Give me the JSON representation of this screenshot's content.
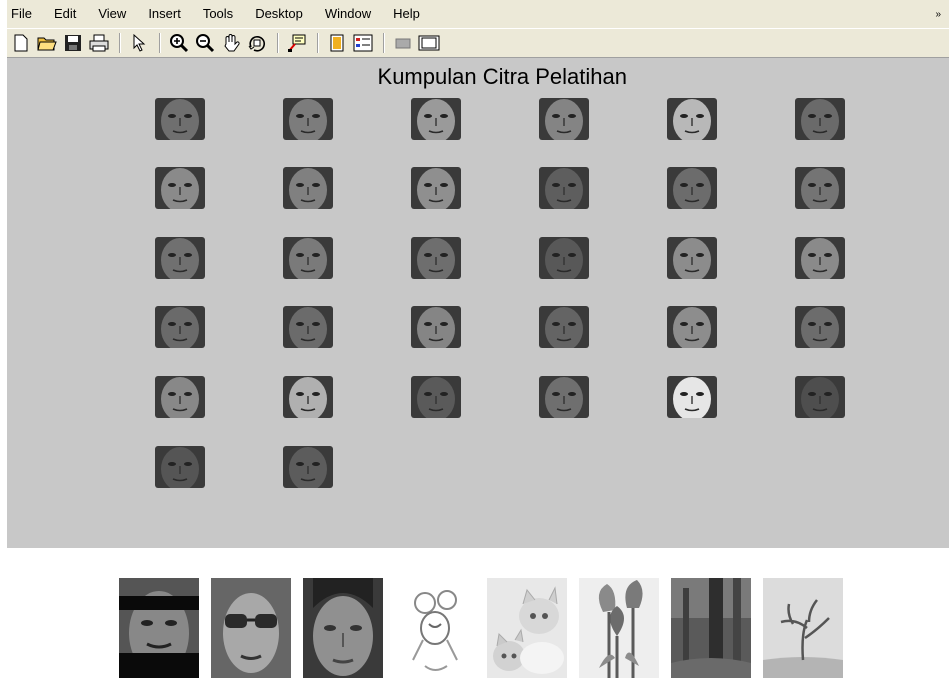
{
  "menubar": {
    "items": [
      "File",
      "Edit",
      "View",
      "Insert",
      "Tools",
      "Desktop",
      "Window",
      "Help"
    ]
  },
  "toolbar": {
    "icons": [
      "new-figure-icon",
      "open-file-icon",
      "save-icon",
      "print-icon",
      "edit-plot-arrow-icon",
      "zoom-in-icon",
      "zoom-out-icon",
      "pan-hand-icon",
      "rotate-3d-icon",
      "data-cursor-icon",
      "colorbar-icon",
      "legend-icon",
      "hide-plot-tools-icon",
      "show-plot-tools-icon"
    ]
  },
  "figure": {
    "title": "Kumpulan Citra Pelatihan",
    "background": "#c8c8c8",
    "faces": [
      {
        "tone": "#6f6f6f"
      },
      {
        "tone": "#7c7c7c"
      },
      {
        "tone": "#9a9a9a"
      },
      {
        "tone": "#848484"
      },
      {
        "tone": "#b8b8b8"
      },
      {
        "tone": "#6a6a6a"
      },
      {
        "tone": "#8a8a8a"
      },
      {
        "tone": "#808080"
      },
      {
        "tone": "#8f8f8f"
      },
      {
        "tone": "#5e5e5e"
      },
      {
        "tone": "#6c6c6c"
      },
      {
        "tone": "#747474"
      },
      {
        "tone": "#707070"
      },
      {
        "tone": "#7a7a7a"
      },
      {
        "tone": "#6e6e6e"
      },
      {
        "tone": "#585858"
      },
      {
        "tone": "#8c8c8c"
      },
      {
        "tone": "#8a8a8a"
      },
      {
        "tone": "#6a6a6a"
      },
      {
        "tone": "#6b6b6b"
      },
      {
        "tone": "#858585"
      },
      {
        "tone": "#646464"
      },
      {
        "tone": "#8d8d8d"
      },
      {
        "tone": "#6c6c6c"
      },
      {
        "tone": "#888888"
      },
      {
        "tone": "#b0b0b0"
      },
      {
        "tone": "#5a5a5a"
      },
      {
        "tone": "#6f6f6f"
      },
      {
        "tone": "#e6e6e6"
      },
      {
        "tone": "#4e4e4e"
      },
      {
        "tone": "#555555"
      },
      {
        "tone": "#5c5c5c"
      }
    ]
  },
  "samples": [
    {
      "kind": "face-occluded"
    },
    {
      "kind": "face-sunglasses"
    },
    {
      "kind": "face"
    },
    {
      "kind": "cartoon"
    },
    {
      "kind": "kittens"
    },
    {
      "kind": "tulips"
    },
    {
      "kind": "forest"
    },
    {
      "kind": "tree"
    }
  ]
}
